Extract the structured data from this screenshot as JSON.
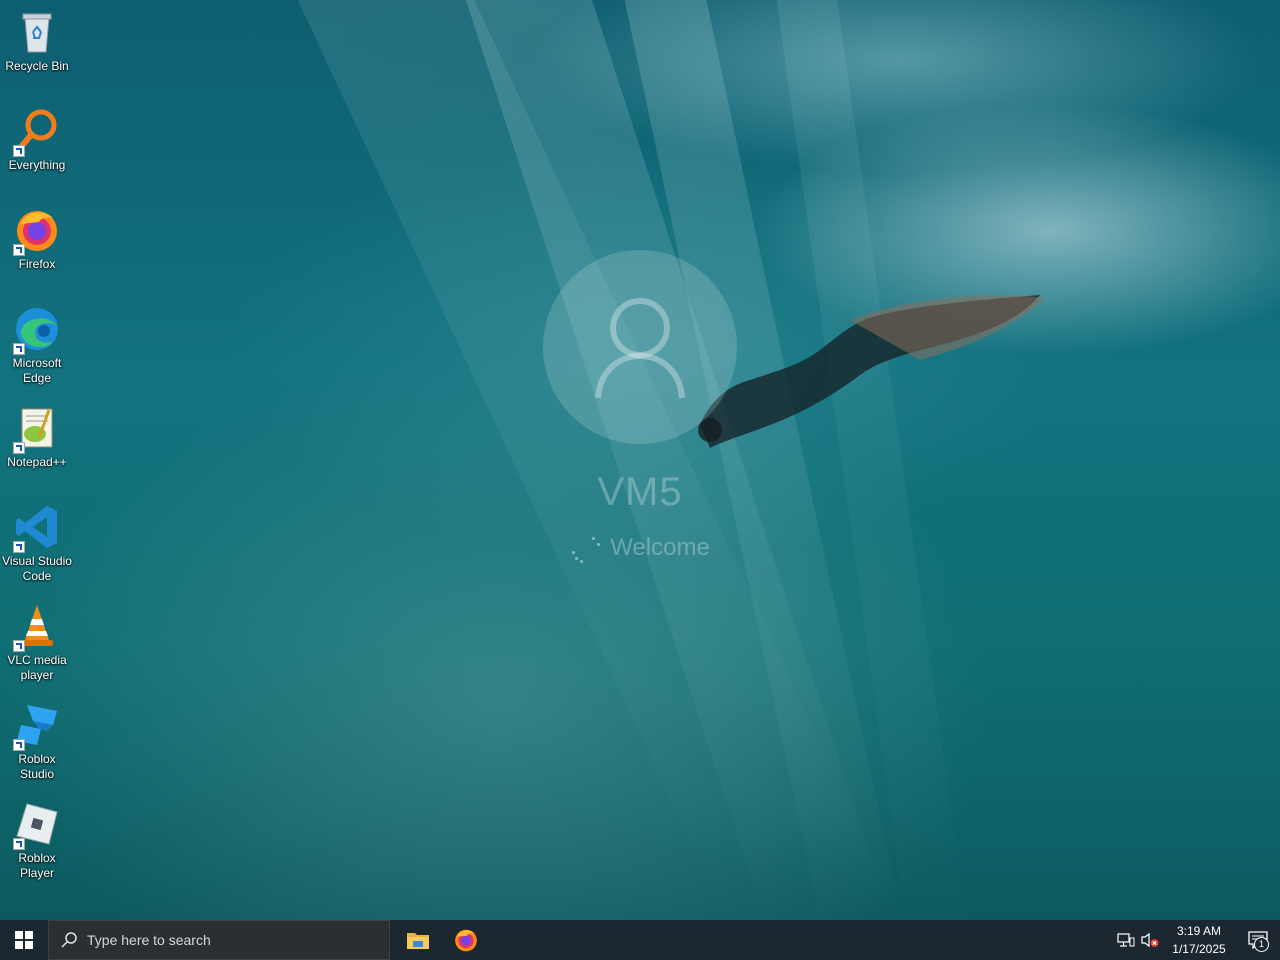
{
  "desktop": {
    "icons": [
      {
        "label": "Recycle Bin",
        "icon": "recycle-bin-icon"
      },
      {
        "label": "Everything",
        "icon": "everything-search-icon"
      },
      {
        "label": "Firefox",
        "icon": "firefox-icon"
      },
      {
        "label": "Microsoft Edge",
        "icon": "edge-icon"
      },
      {
        "label": "Notepad++",
        "icon": "notepad-plus-plus-icon"
      },
      {
        "label": "Visual Studio Code",
        "icon": "vscode-icon"
      },
      {
        "label": "VLC media player",
        "icon": "vlc-icon"
      },
      {
        "label": "Roblox Studio",
        "icon": "roblox-studio-icon"
      },
      {
        "label": "Roblox Player",
        "icon": "roblox-player-icon"
      }
    ]
  },
  "login": {
    "username": "VM5",
    "status": "Welcome"
  },
  "taskbar": {
    "search_placeholder": "Type here to search",
    "pinned": [
      "file-explorer-icon",
      "firefox-icon"
    ],
    "clock_time": "3:19 AM",
    "clock_date": "1/17/2025",
    "notification_count": "1"
  },
  "colors": {
    "taskbar_bg": "#1c2730",
    "search_bg": "#2b2f34"
  }
}
